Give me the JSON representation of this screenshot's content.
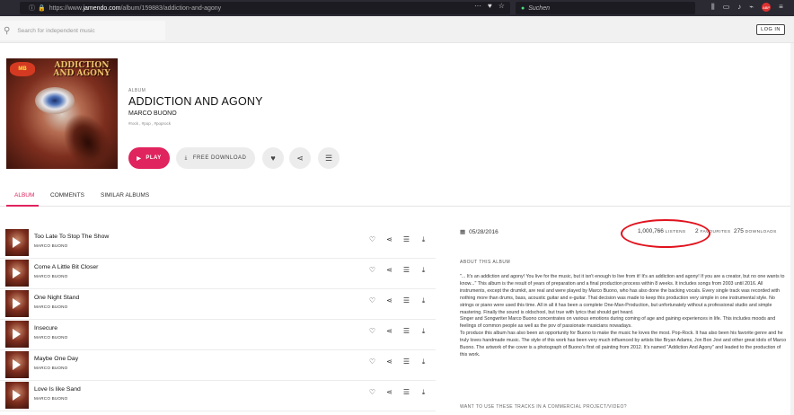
{
  "browser": {
    "url_prefix": "https://www.",
    "url_host": "jamendo.com",
    "url_path": "/album/159883/addiction-and-agony",
    "search_placeholder": "Suchen"
  },
  "site": {
    "search_placeholder": "Search for independent music",
    "login_label": "LOG IN"
  },
  "album": {
    "kicker": "ALBUM",
    "title": "ADDICTION AND AGONY",
    "artist": "MARCO BUONO",
    "tags": "#rock , #pop , #poprock",
    "cover_title": "ADDICTION AND AGONY",
    "cover_logo": "MB"
  },
  "actions": {
    "play_label": "PLAY",
    "download_label": "FREE DOWNLOAD"
  },
  "tabs": [
    "ALBUM",
    "COMMENTS",
    "SIMILAR ALBUMS"
  ],
  "tracks": [
    {
      "name": "Too Late To Stop The Show",
      "artist": "MARCO BUONO"
    },
    {
      "name": "Come A Little Bit Closer",
      "artist": "MARCO BUONO"
    },
    {
      "name": "One Night Stand",
      "artist": "MARCO BUONO"
    },
    {
      "name": "Insecure",
      "artist": "MARCO BUONO"
    },
    {
      "name": "Maybe One Day",
      "artist": "MARCO BUONO"
    },
    {
      "name": "Love Is like Sand",
      "artist": "MARCO BUONO"
    }
  ],
  "stats": {
    "date": "05/28/2016",
    "listens_value": "1,000,766",
    "listens_label": "LISTENS",
    "favourites_value": "2",
    "favourites_label": "FAVOURITES",
    "downloads_value": "275",
    "downloads_label": "DOWNLOADS"
  },
  "about": {
    "heading": "ABOUT THIS ALBUM",
    "paragraphs": [
      "\"... It's an addiction and agony! You live for the music, but it isn't enough to live from it! It's an addiction and agony! If you are a creator, but no one wants to know...\" This album is the result of years of preparation and a final production process within 8 weeks. It includes songs from 2003 until 2016. All instruments, except the drumkit, are real and were played by Marco Buono, who has also done the backing vocals. Every single track was recorded with nothing more than drums, bass, acoustic guitar and e-guitar. That decision was made to keep this production very simple in one instrumental style. No strings or piano were used this time. All in all it has been a complete One-Man-Production, but unfortunately without a professional studio and simple mastering. Finally the sound is oldschool, but true with lyrics that should get heard.",
      "Singer and Songwriter Marco Buono concentrates on various emotions during coming of age and gaining experiences in life. This includes moods and feelings of common people as well as the pov of passionate musicians nowadays.",
      "To produce this album has also been an opportunity for Buono to make the music he loves the most. Pop-Rock. It has also been his favorite genre and he truly loves handmade music. The style of this work has been very much influenced by artists like Bryan Adams, Jon Bon Jovi and other great idols of Marco Buono. The artwork of the cover is a photograph of Buono's first oil painting from 2012. It's named \"Addiction And Agony\" and leaded to the production of this work."
    ],
    "commercial_heading": "WANT TO USE THESE TRACKS IN A COMMERCIAL PROJECT/VIDEO?"
  },
  "colors": {
    "accent": "#e0245e",
    "highlight_ring": "#e0121d",
    "browser_bar": "#2b2a33"
  },
  "icons": {
    "heart": "heart-icon",
    "share": "share-icon",
    "add_to_playlist": "playlist-add-icon",
    "download": "download-icon",
    "calendar": "calendar-icon"
  }
}
